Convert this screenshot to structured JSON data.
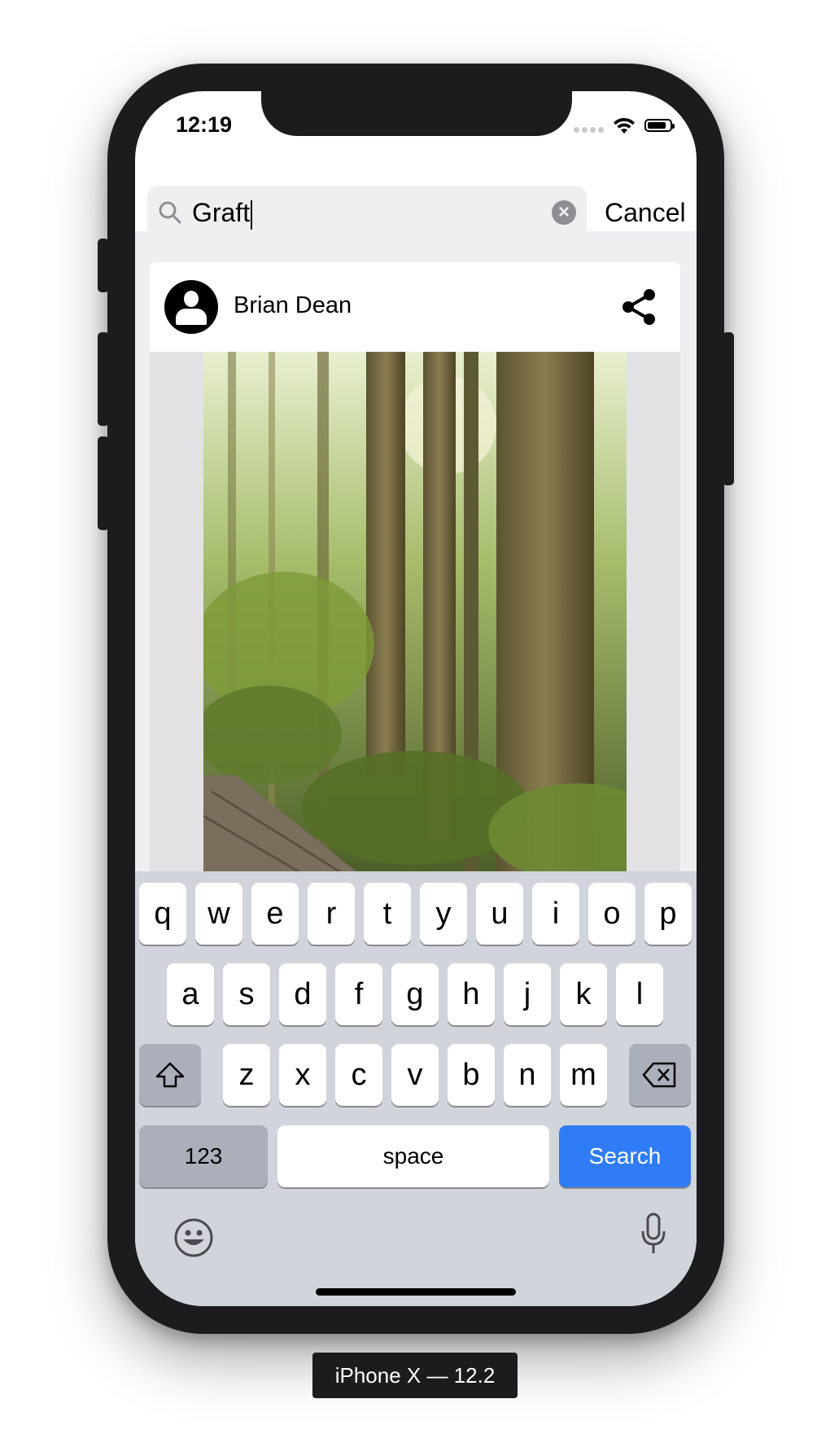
{
  "status_bar": {
    "time": "12:19"
  },
  "search": {
    "query": "Graft",
    "cancel_label": "Cancel"
  },
  "post": {
    "author": "Brian Dean"
  },
  "keyboard": {
    "row1": [
      "q",
      "w",
      "e",
      "r",
      "t",
      "y",
      "u",
      "i",
      "o",
      "p"
    ],
    "row2": [
      "a",
      "s",
      "d",
      "f",
      "g",
      "h",
      "j",
      "k",
      "l"
    ],
    "row3": [
      "z",
      "x",
      "c",
      "v",
      "b",
      "n",
      "m"
    ],
    "numbers_label": "123",
    "space_label": "space",
    "search_label": "Search"
  },
  "device_label": "iPhone X — 12.2",
  "colors": {
    "search_key": "#2f7cf6",
    "keyboard_bg": "#d1d4db",
    "device": "#1c1c1e"
  }
}
